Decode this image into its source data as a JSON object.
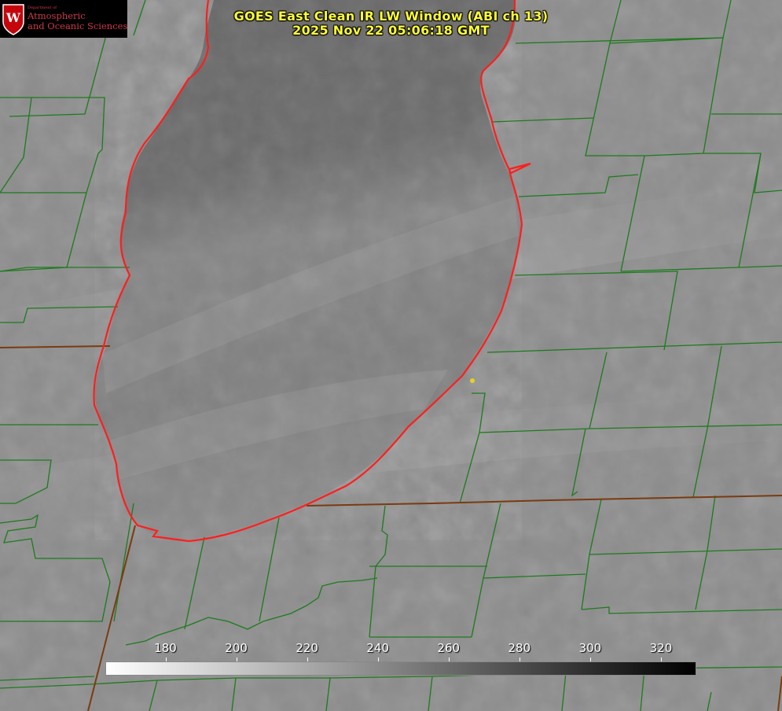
{
  "title": {
    "line1": "GOES East Clean IR LW Window (ABI ch 13)",
    "line2": "2025 Nov 22 05:06:18 GMT"
  },
  "logo": {
    "dept": "Department of",
    "line1": "Atmospheric",
    "line2": "and Oceanic Sciences"
  },
  "colorbar": {
    "ticks": [
      "180",
      "200",
      "220",
      "240",
      "260",
      "280",
      "300",
      "320"
    ],
    "tick_values": [
      180,
      200,
      220,
      240,
      260,
      280,
      300,
      320
    ],
    "range": [
      163,
      330
    ],
    "gradient": [
      "#ffffff",
      "#000000"
    ]
  },
  "colors": {
    "county_lines": "#1e7a1e",
    "state_lines": "#7a3b10",
    "shoreline": "#ff2020",
    "marker": "#e8d020",
    "title": "#ffff33"
  }
}
